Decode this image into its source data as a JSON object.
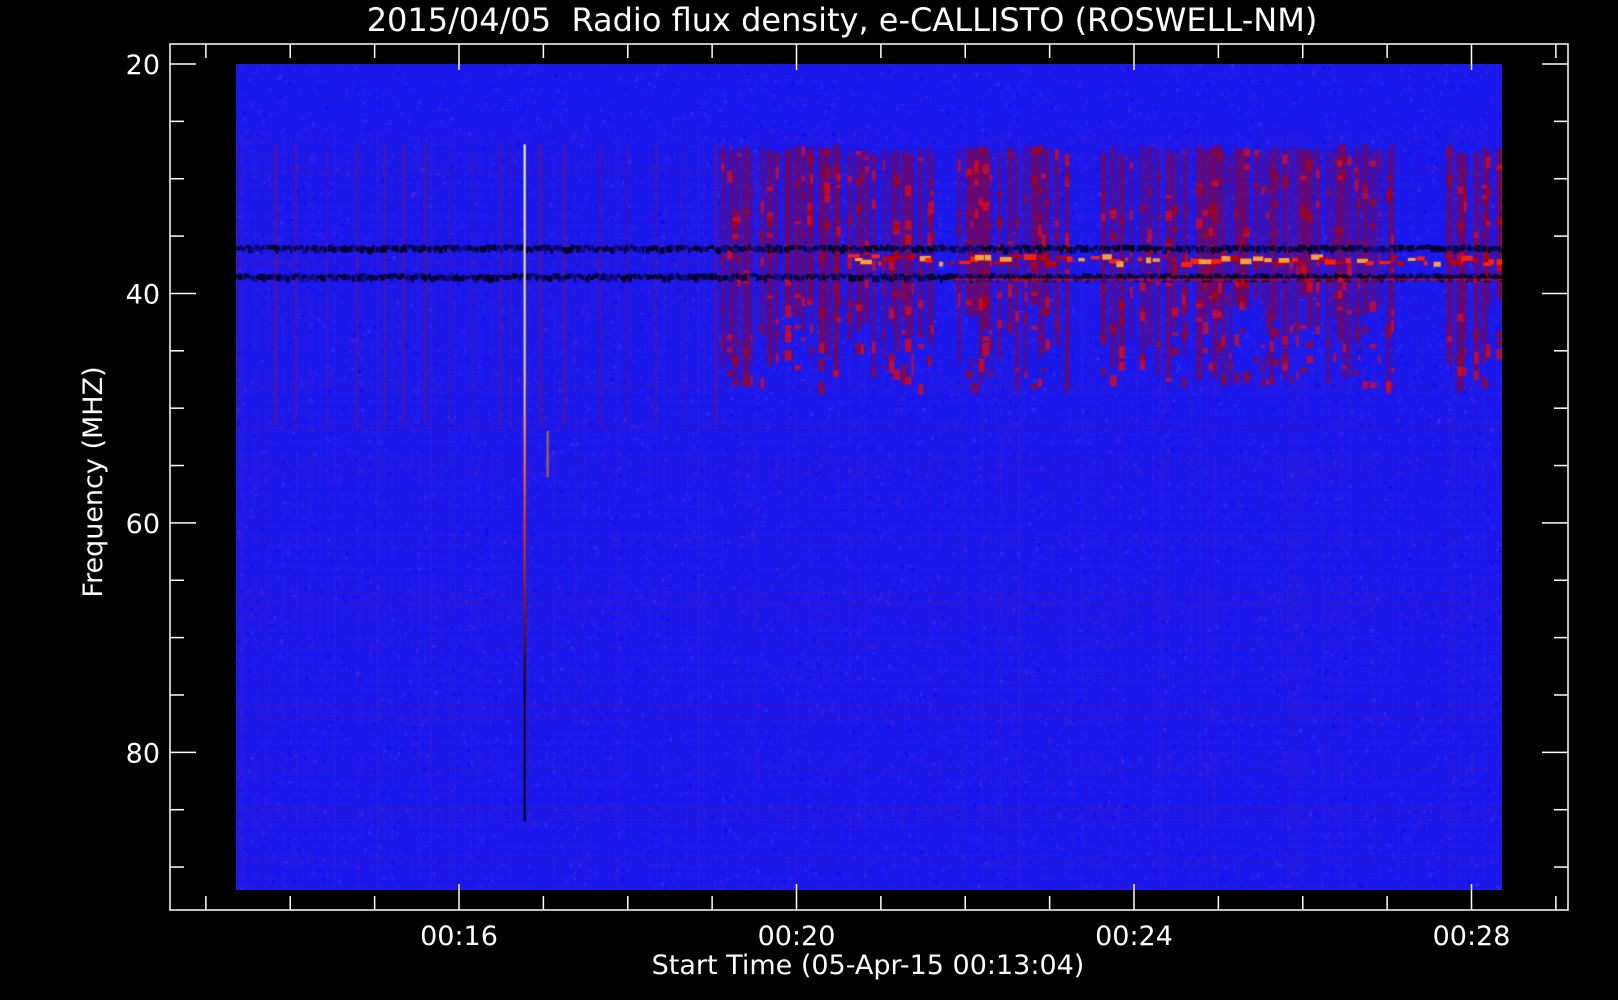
{
  "chart_data": {
    "type": "heatmap",
    "title": "2015/04/05  Radio flux density, e-CALLISTO (ROSWELL-NM)",
    "xlabel": "Start Time (05-Apr-15 00:13:04)",
    "ylabel": "Frequency (MHZ)",
    "y_axis": {
      "range": [
        20,
        92
      ],
      "inverted": true,
      "major_ticks": [
        20,
        40,
        60,
        80
      ],
      "tick_labels": [
        "20",
        "40",
        "60",
        "80"
      ],
      "minor_step": 5
    },
    "x_axis": {
      "range_minutes": [
        13.0,
        29.0
      ],
      "major_ticks_minutes": [
        16,
        20,
        24,
        28
      ],
      "tick_labels": [
        "00:16",
        "00:20",
        "00:24",
        "00:28"
      ],
      "minor_step_minutes": 1
    },
    "data_extent": {
      "time_minutes": [
        13.75,
        28.75
      ],
      "frequency_mhz": [
        20,
        92
      ]
    },
    "colormap": [
      "#000000",
      "#2a2aff",
      "#0000ff",
      "#800000",
      "#ff0000",
      "#ffa000",
      "#ffffff"
    ],
    "features": {
      "background_color": "#1a1aee",
      "burst_time_minutes": 17.17,
      "burst_freq_range": [
        27,
        86
      ],
      "dark_band_freqs": [
        36,
        38.5
      ],
      "bright_band_freq": 37,
      "rfi_time_ranges": [
        [
          19.5,
          21.2
        ],
        [
          21.2,
          22.0
        ],
        [
          22.3,
          23.6
        ],
        [
          24.0,
          25.0
        ],
        [
          25.0,
          26.0
        ],
        [
          26.0,
          27.5
        ],
        [
          28.1,
          28.75
        ]
      ],
      "rfi_freq_range": [
        27,
        48
      ]
    }
  }
}
